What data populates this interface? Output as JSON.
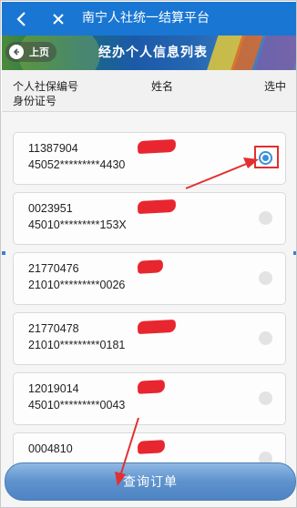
{
  "header": {
    "title": "南宁人社统一结算平台",
    "back_icon": "chevron-left-icon",
    "close_icon": "close-icon"
  },
  "banner": {
    "prev_label": "上页",
    "title": "经办个人信息列表"
  },
  "columns": {
    "social_id": "个人社保编号",
    "id_card": "身份证号",
    "name": "姓名",
    "select": "选中"
  },
  "records": [
    {
      "social_id": "11387904",
      "id_card": "45052*********4430",
      "selected": true
    },
    {
      "social_id": "0023951",
      "id_card": "45010*********153X",
      "selected": false
    },
    {
      "social_id": "21770476",
      "id_card": "21010*********0026",
      "selected": false
    },
    {
      "social_id": "21770478",
      "id_card": "21010*********0181",
      "selected": false
    },
    {
      "social_id": "12019014",
      "id_card": "45010*********0043",
      "selected": false
    },
    {
      "social_id": "0004810",
      "id_card": "",
      "selected": false
    }
  ],
  "footer": {
    "query_label": "查询订单"
  },
  "colors": {
    "navbar": "#1976d2",
    "accent": "#3b8fd8",
    "annotation": "#e23030"
  }
}
